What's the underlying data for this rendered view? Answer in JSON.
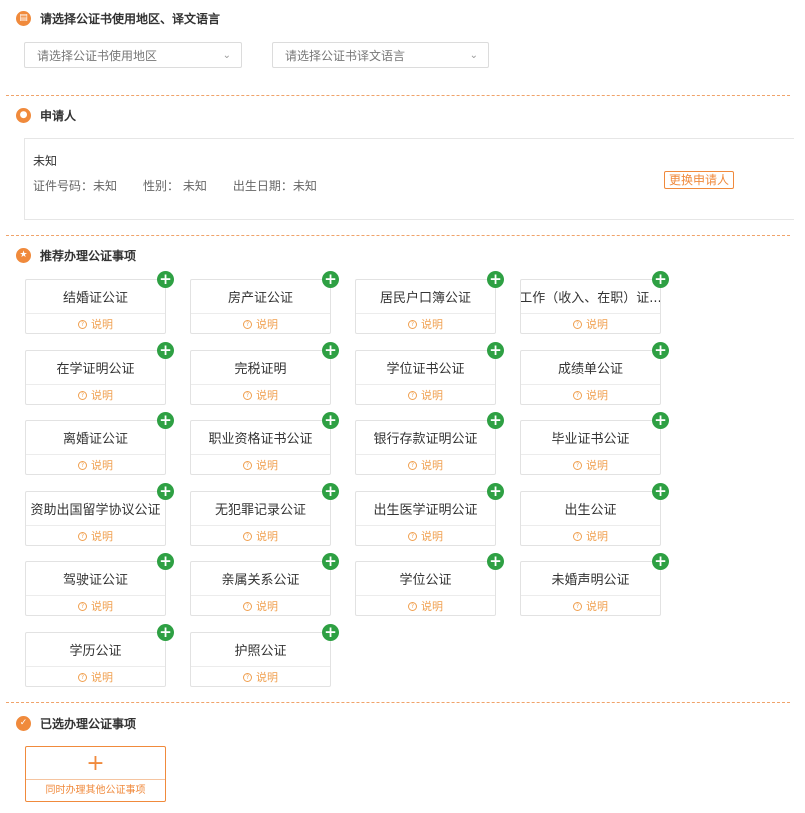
{
  "region_section": {
    "title": "请选择公证书使用地区、译文语言",
    "region_select_placeholder": "请选择公证书使用地区",
    "language_select_placeholder": "请选择公证书译文语言"
  },
  "applicant_section": {
    "title": "申请人",
    "name": "未知",
    "id_text": "证件号码：未知",
    "gender_text": "性别： 未知",
    "birth_text": "出生日期：未知",
    "change_button": "更换申请人"
  },
  "recommended_section": {
    "title": "推荐办理公证事项",
    "info_label": "说明",
    "items": [
      {
        "name": "结婚证公证"
      },
      {
        "name": "房产证公证"
      },
      {
        "name": "居民户口簿公证"
      },
      {
        "name": "工作（收入、在职）证..."
      },
      {
        "name": "在学证明公证"
      },
      {
        "name": "完税证明"
      },
      {
        "name": "学位证书公证"
      },
      {
        "name": "成绩单公证"
      },
      {
        "name": "离婚证公证"
      },
      {
        "name": "职业资格证书公证"
      },
      {
        "name": "银行存款证明公证"
      },
      {
        "name": "毕业证书公证"
      },
      {
        "name": "资助出国留学协议公证"
      },
      {
        "name": "无犯罪记录公证"
      },
      {
        "name": "出生医学证明公证"
      },
      {
        "name": "出生公证"
      },
      {
        "name": "驾驶证公证"
      },
      {
        "name": "亲属关系公证"
      },
      {
        "name": "学位公证"
      },
      {
        "name": "未婚声明公证"
      },
      {
        "name": "学历公证"
      },
      {
        "name": "护照公证"
      }
    ]
  },
  "selected_section": {
    "title": "已选办理公证事项",
    "add_other_label": "同时办理其他公证事项"
  },
  "colors": {
    "accent": "#f08a3c",
    "add_green": "#2ea043"
  }
}
